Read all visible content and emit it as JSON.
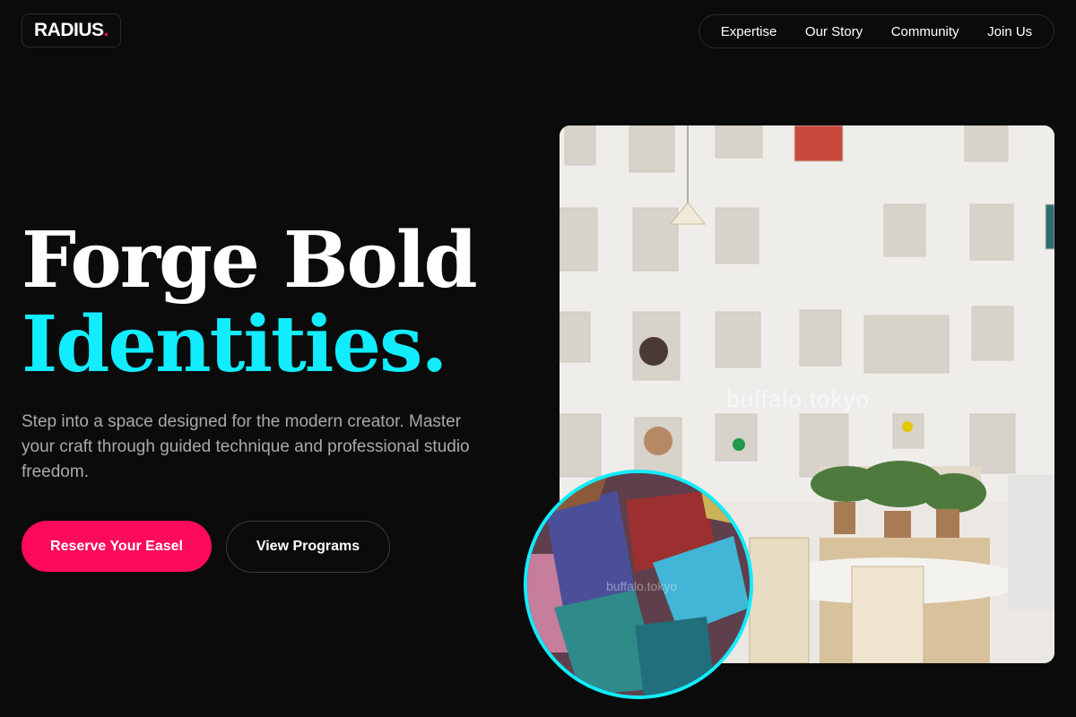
{
  "brand": {
    "name": "RADIUS",
    "dot": "."
  },
  "nav": {
    "items": [
      "Expertise",
      "Our Story",
      "Community",
      "Join Us"
    ]
  },
  "hero": {
    "title_line1": "Forge Bold",
    "title_line2": "Identities.",
    "description": "Step into a space designed for the modern creator. Master your craft through guided technique and professional studio freedom.",
    "primary_cta": "Reserve Your Easel",
    "secondary_cta": "View Programs"
  },
  "images": {
    "studio_alt": "Studio wall with clipboards, plants and tables",
    "studio_watermark": "buffalo.tokyo",
    "brushes_alt": "Close-up of paint brushes",
    "brushes_watermark": "buffalo.tokyo"
  },
  "colors": {
    "accent": "#12ecff",
    "brand": "#ff0a5c",
    "background": "#0b0b0c"
  }
}
